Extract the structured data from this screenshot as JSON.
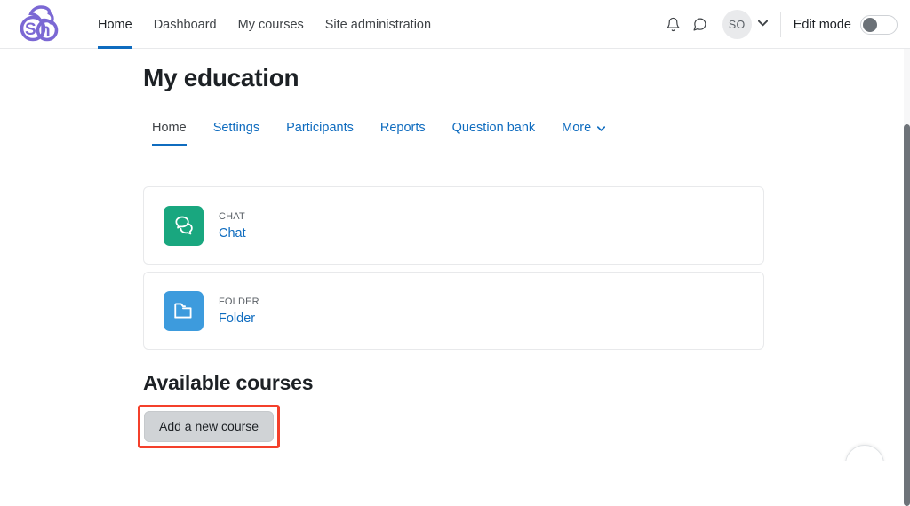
{
  "navbar": {
    "logo_name": "shine-cloud-logo",
    "logo_text": "Sh",
    "brand_color": "#7b68d4",
    "items": [
      {
        "label": "Home",
        "active": true
      },
      {
        "label": "Dashboard",
        "active": false
      },
      {
        "label": "My courses",
        "active": false
      },
      {
        "label": "Site administration",
        "active": false
      }
    ],
    "notifications_icon": "bell-icon",
    "messages_icon": "message-bubble-icon",
    "avatar_initials": "SO",
    "user_menu_caret": "⌄",
    "edit_mode": {
      "label": "Edit mode",
      "enabled": false
    }
  },
  "main": {
    "page_title": "My education",
    "tabs": [
      {
        "label": "Home",
        "active": true,
        "caret": ""
      },
      {
        "label": "Settings",
        "active": false,
        "caret": ""
      },
      {
        "label": "Participants",
        "active": false,
        "caret": ""
      },
      {
        "label": "Reports",
        "active": false,
        "caret": ""
      },
      {
        "label": "Question bank",
        "active": false,
        "caret": ""
      },
      {
        "label": "More",
        "active": false,
        "caret": "⌄"
      }
    ],
    "activities": [
      {
        "type_label": "CHAT",
        "name": "Chat",
        "icon": "chat-bubbles-icon",
        "icon_bg": "#19a77f"
      },
      {
        "type_label": "FOLDER",
        "name": "Folder",
        "icon": "folder-icon",
        "icon_bg": "#3d9bdd"
      }
    ],
    "courses_section": {
      "title": "Available courses",
      "add_course_button": "Add a new course",
      "highlight_color": "#f4402b"
    }
  }
}
